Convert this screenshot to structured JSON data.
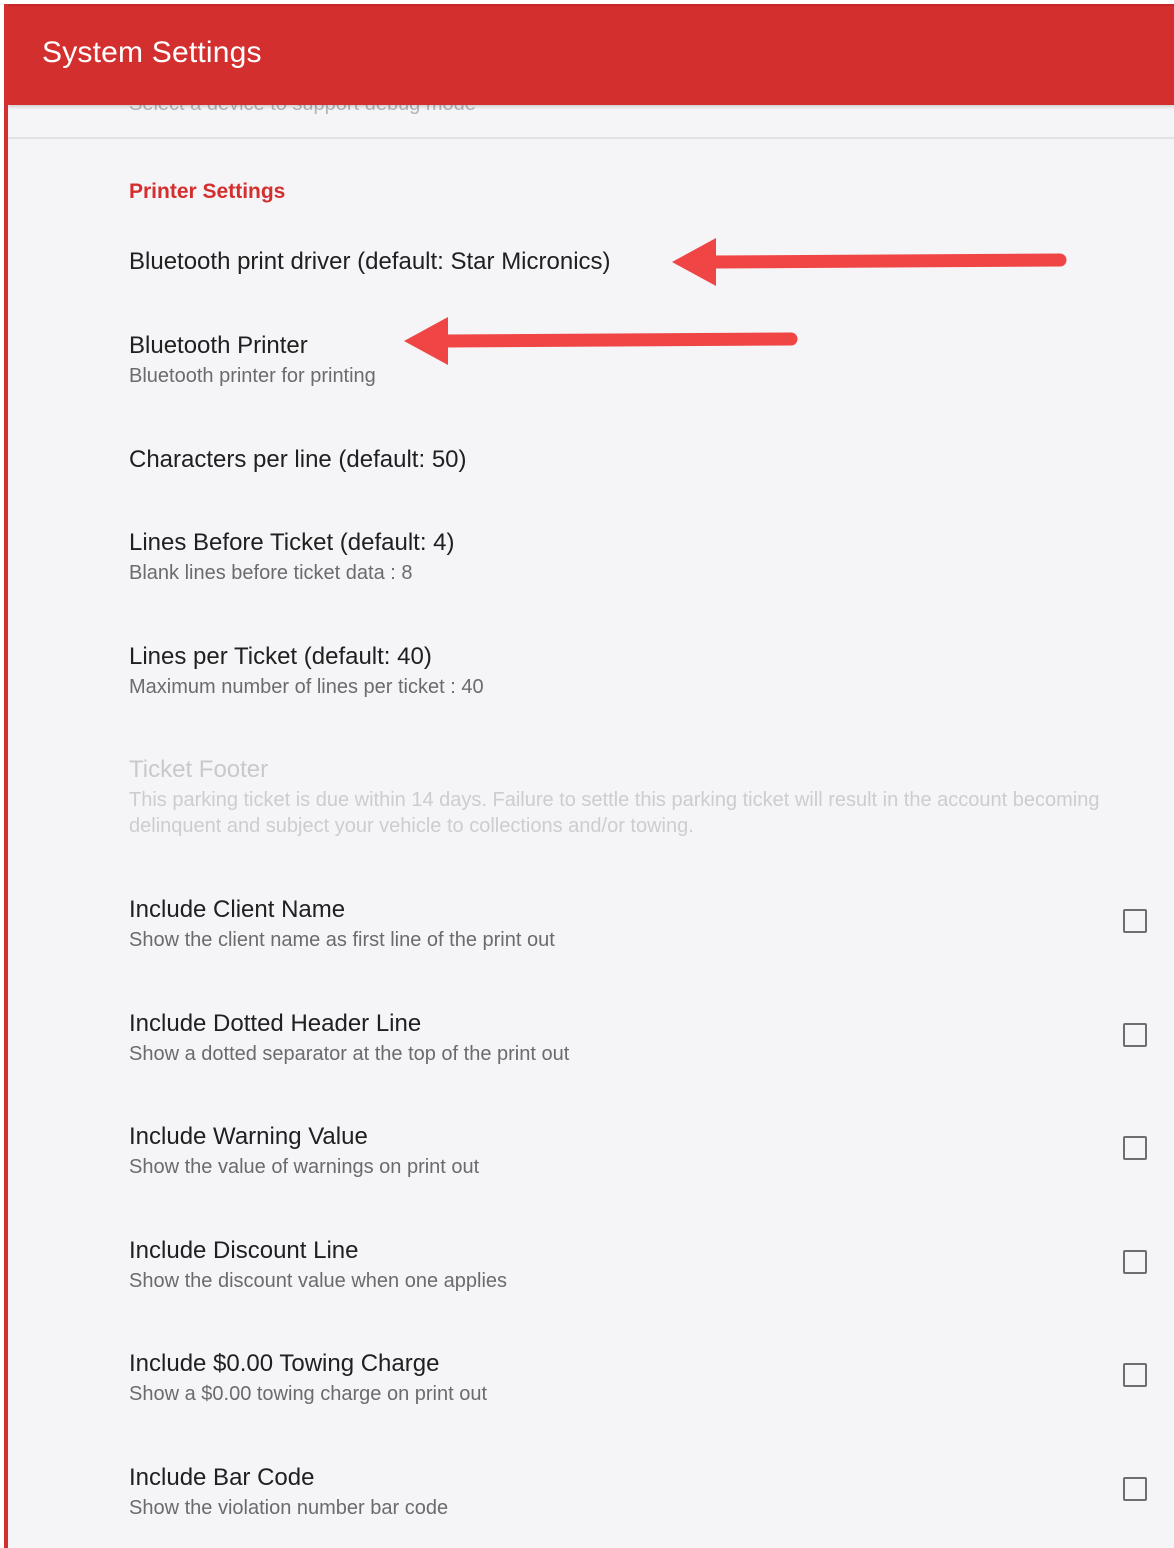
{
  "appbar": {
    "title": "System Settings",
    "color": "#d32f2f"
  },
  "hidden_row": {
    "summary": "Select a device to support debug mode"
  },
  "section": {
    "label": "Printer Settings",
    "color": "#d32f2f"
  },
  "prefs": {
    "print_driver": {
      "title": "Bluetooth print driver (default: Star Micronics)"
    },
    "printer": {
      "title": "Bluetooth Printer",
      "summary": "Bluetooth printer for printing"
    },
    "chars_per_line": {
      "title": "Characters per line (default: 50)"
    },
    "lines_before": {
      "title": "Lines Before Ticket (default: 4)",
      "summary": "Blank lines before ticket data : 8"
    },
    "lines_per_ticket": {
      "title": "Lines per Ticket (default: 40)",
      "summary": "Maximum number of lines per ticket : 40"
    },
    "ticket_footer": {
      "title": "Ticket Footer",
      "summary": "This parking ticket is due within 14 days. Failure to settle this parking ticket will result in the account becoming delinquent and subject your vehicle to collections and/or towing.",
      "enabled": false
    },
    "client_name": {
      "title": "Include Client Name",
      "summary": "Show the client name as first line of the print out",
      "checked": false
    },
    "dotted_header": {
      "title": "Include Dotted Header Line",
      "summary": "Show a dotted separator at the top of the print out",
      "checked": false
    },
    "warning_value": {
      "title": "Include Warning Value",
      "summary": "Show the value of warnings on print out",
      "checked": false
    },
    "discount_line": {
      "title": "Include Discount Line",
      "summary": "Show the discount value when one applies",
      "checked": false
    },
    "towing_charge": {
      "title": "Include $0.00 Towing Charge",
      "summary": "Show a $0.00 towing charge on print out",
      "checked": false
    },
    "bar_code": {
      "title": "Include Bar Code",
      "summary": "Show the violation number bar code",
      "checked": false
    }
  },
  "annotations": {
    "arrow_color": "#f04545"
  }
}
